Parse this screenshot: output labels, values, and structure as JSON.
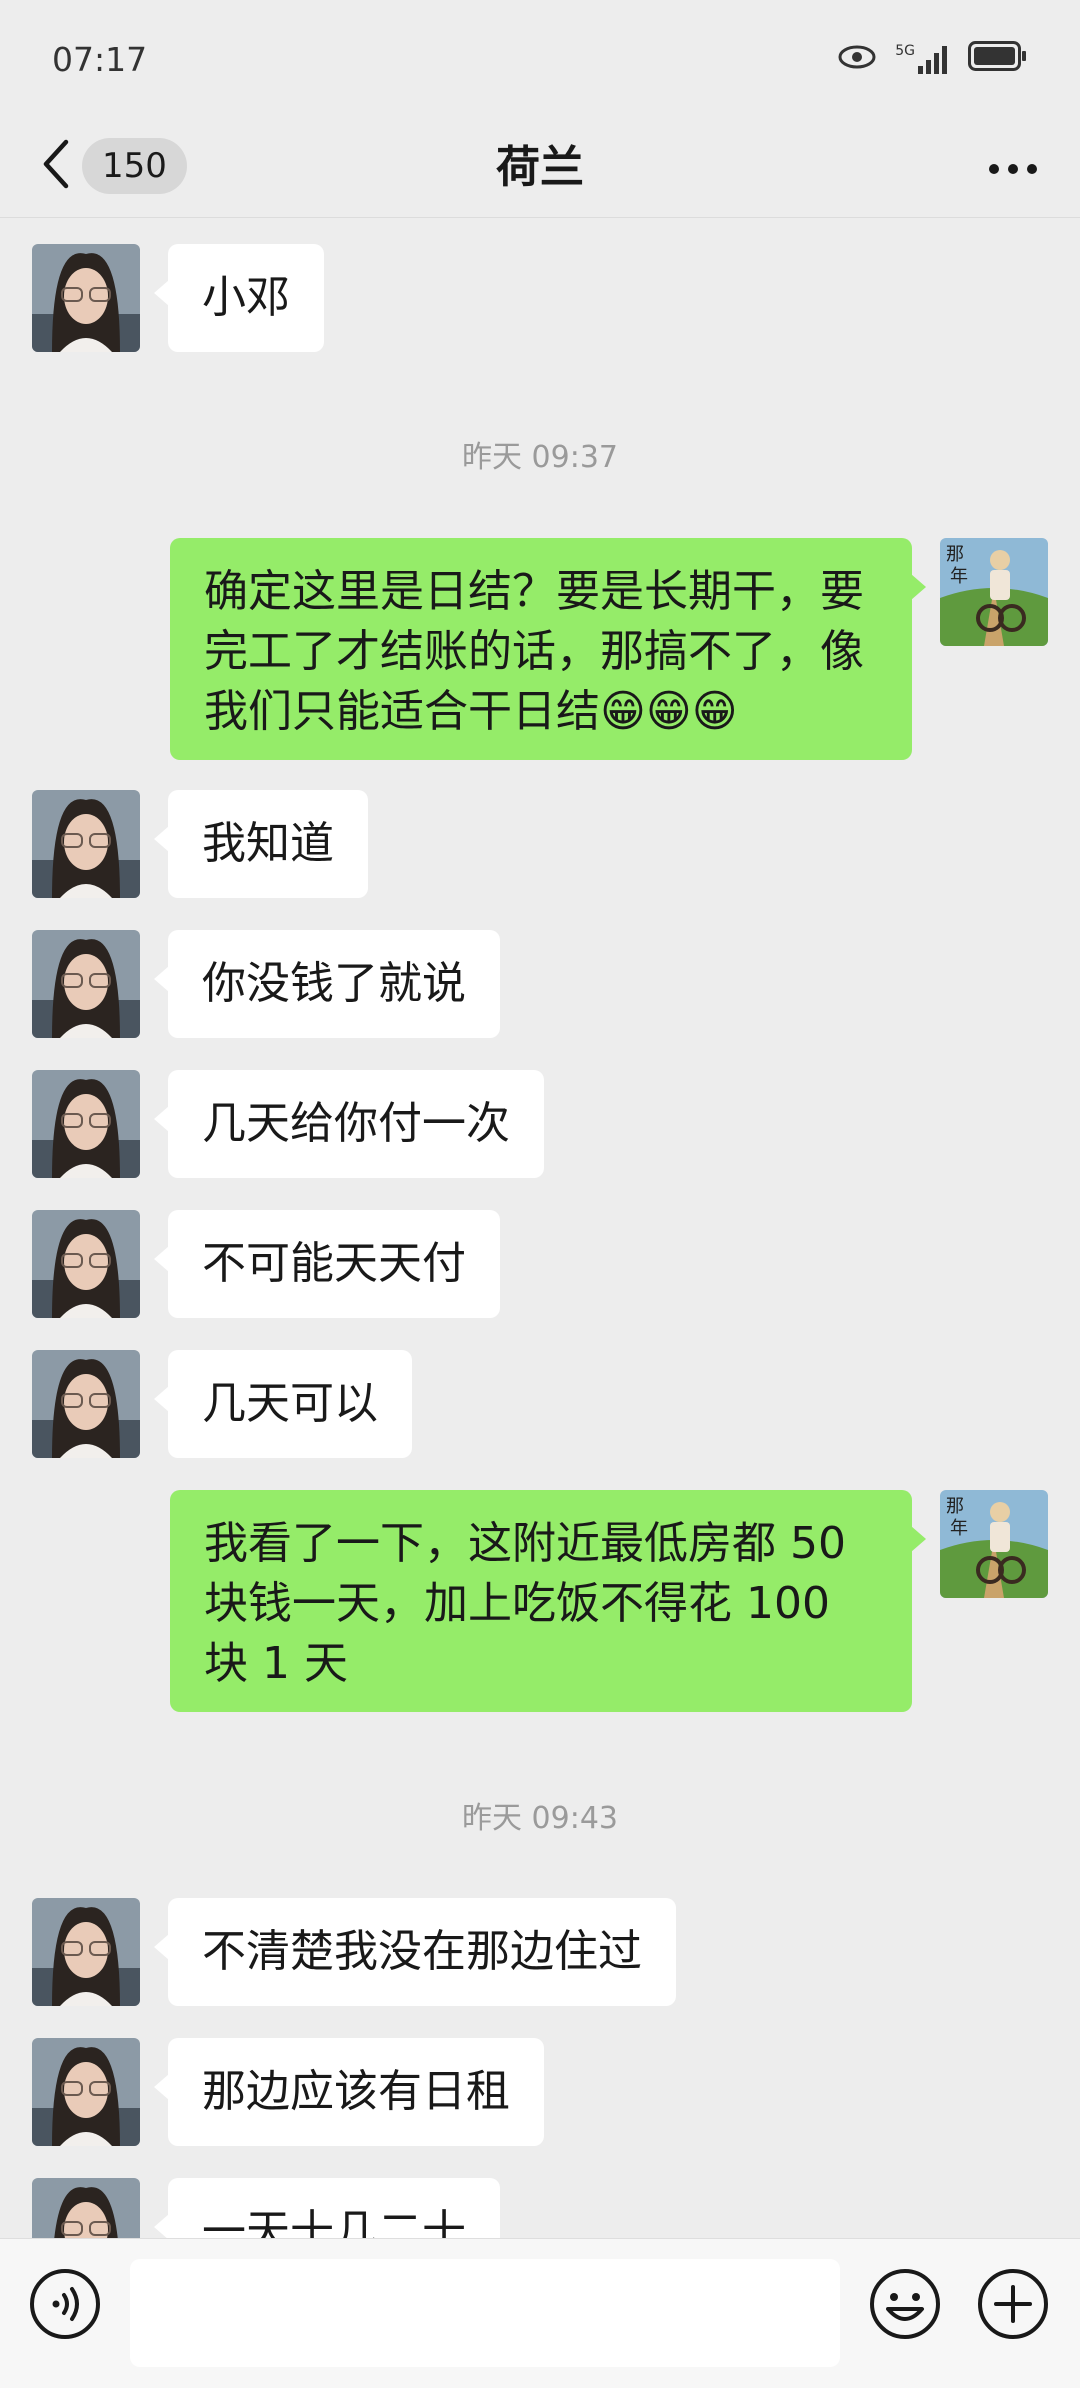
{
  "status": {
    "time": "07:17",
    "signal": "5G"
  },
  "nav": {
    "unread_count": "150",
    "title": "荷兰"
  },
  "messages": [
    {
      "side": "in",
      "text": "小邓"
    },
    {
      "timestamp": "昨天 09:37"
    },
    {
      "side": "out",
      "text": "确定这里是日结？要是长期干，要完工了才结账的话，那搞不了，像我们只能适合干日结😁😁😁"
    },
    {
      "side": "in",
      "text": "我知道"
    },
    {
      "side": "in",
      "text": "你没钱了就说"
    },
    {
      "side": "in",
      "text": "几天给你付一次"
    },
    {
      "side": "in",
      "text": "不可能天天付"
    },
    {
      "side": "in",
      "text": "几天可以"
    },
    {
      "side": "out",
      "text": "我看了一下，这附近最低房都 50 块钱一天，加上吃饭不得花 100 块 1 天"
    },
    {
      "timestamp": "昨天 09:43"
    },
    {
      "side": "in",
      "text": "不清楚我没在那边住过"
    },
    {
      "side": "in",
      "text": "那边应该有日租"
    },
    {
      "side": "in",
      "text": "一天十几二十"
    }
  ],
  "colors": {
    "outgoing_bubble": "#95ec69",
    "incoming_bubble": "#ffffff",
    "background": "#ededed"
  },
  "icons": [
    "back-icon",
    "more-icon",
    "voice-icon",
    "emoji-icon",
    "plus-icon",
    "eye-icon",
    "signal-icon",
    "battery-icon"
  ]
}
